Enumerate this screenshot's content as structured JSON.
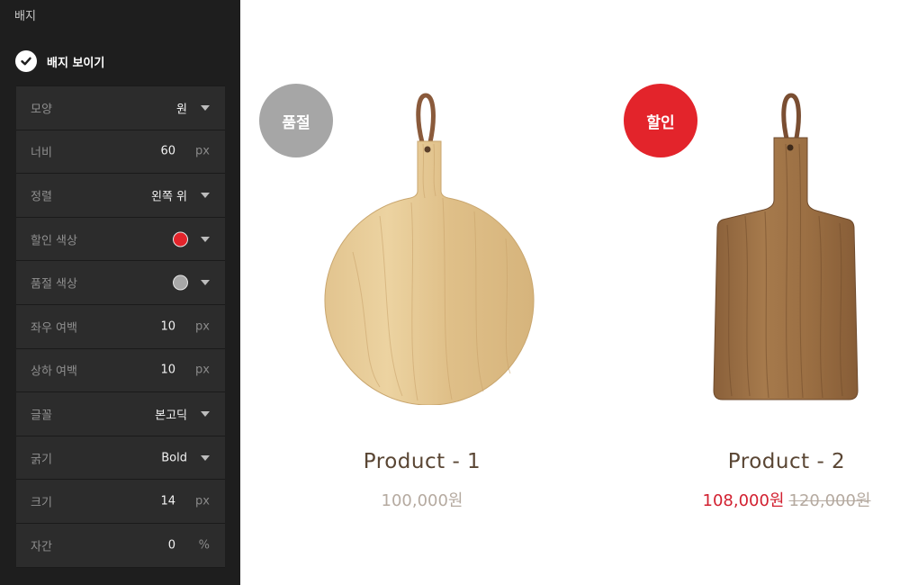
{
  "sidebar": {
    "section_title": "배지",
    "show_badge_label": "배지 보이기",
    "settings": {
      "shape": {
        "label": "모양",
        "value": "원"
      },
      "width": {
        "label": "너비",
        "value": "60",
        "unit": "px"
      },
      "align": {
        "label": "정렬",
        "value": "왼쪽 위"
      },
      "sale_color": {
        "label": "할인 색상",
        "color": "#e3242b"
      },
      "soldout_color": {
        "label": "품절 색상",
        "color": "#a8a8a8"
      },
      "h_margin": {
        "label": "좌우 여백",
        "value": "10",
        "unit": "px"
      },
      "v_margin": {
        "label": "상하 여백",
        "value": "10",
        "unit": "px"
      },
      "font": {
        "label": "글꼴",
        "value": "본고딕"
      },
      "weight": {
        "label": "굵기",
        "value": "Bold"
      },
      "size": {
        "label": "크기",
        "value": "14",
        "unit": "px"
      },
      "spacing": {
        "label": "자간",
        "value": "0",
        "unit": "%"
      }
    }
  },
  "products": [
    {
      "badge": "품절",
      "badge_color": "#a6a6a6",
      "name": "Product - 1",
      "price": "100,000원"
    },
    {
      "badge": "할인",
      "badge_color": "#e3242b",
      "name": "Product - 2",
      "sale_price": "108,000원",
      "original_price": "120,000원"
    }
  ]
}
